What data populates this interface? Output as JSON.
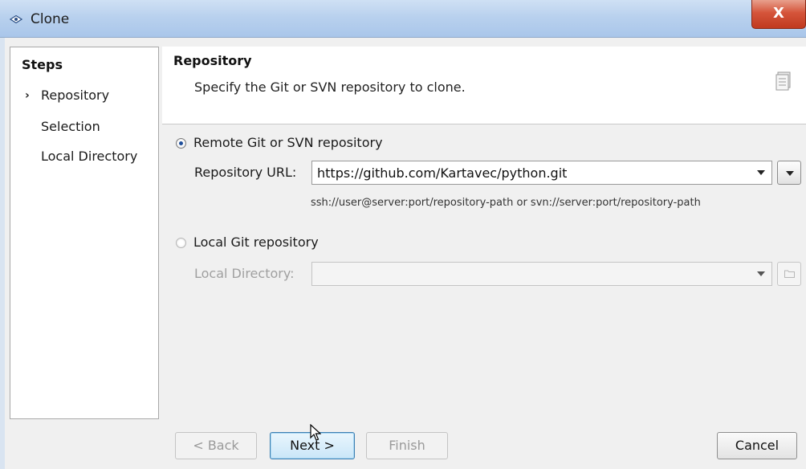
{
  "window": {
    "title": "Clone",
    "close_label": "X"
  },
  "steps": {
    "title": "Steps",
    "items": [
      {
        "label": "Repository",
        "current": true
      },
      {
        "label": "Selection",
        "current": false
      },
      {
        "label": "Local Directory",
        "current": false
      }
    ]
  },
  "header": {
    "title": "Repository",
    "description": "Specify the Git or SVN repository to clone."
  },
  "remote": {
    "radio_label": "Remote Git or SVN repository",
    "selected": true,
    "url_label": "Repository URL:",
    "url_value": "https://github.com/Kartavec/python.git",
    "hint": "ssh://user@server:port/repository-path or svn://server:port/repository-path"
  },
  "local": {
    "radio_label": "Local Git repository",
    "selected": false,
    "dir_label": "Local Directory:",
    "dir_value": ""
  },
  "buttons": {
    "back": "< Back",
    "next": "Next >",
    "finish": "Finish",
    "cancel": "Cancel"
  },
  "icons": {
    "title": "eye-icon",
    "header": "wizard-page-icon",
    "dropdown": "chevron-down-icon",
    "browse": "folder-icon"
  }
}
